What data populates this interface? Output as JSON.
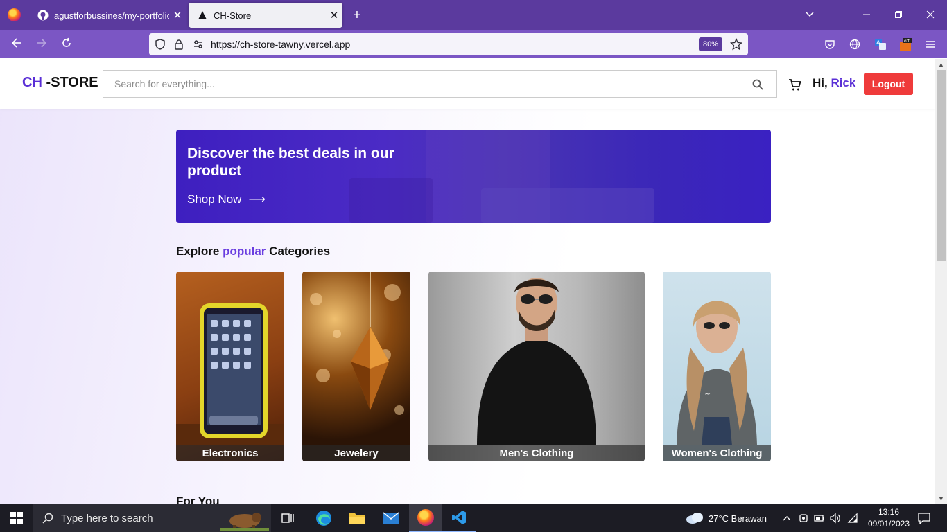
{
  "browser": {
    "tabs": [
      {
        "title": "agustforbussines/my-portfolio",
        "active": false,
        "icon": "github-icon"
      },
      {
        "title": "CH-Store",
        "active": true,
        "icon": "vercel-triangle-icon"
      }
    ],
    "new_tab": "+",
    "url": "https://ch-store-tawny.vercel.app",
    "zoom": "80%",
    "window_controls": {
      "dropdown": "⌄",
      "minimize": "—",
      "restore": "❐",
      "close": "✕"
    }
  },
  "site": {
    "logo_accent": "CH",
    "logo_rest": " -STORE",
    "search_placeholder": "Search for everything...",
    "greeting_prefix": "Hi, ",
    "user_name": "Rick",
    "logout_label": "Logout"
  },
  "hero": {
    "title": "Discover the best deals in our product",
    "cta": "Shop Now",
    "cta_arrow": "⟶"
  },
  "categories_section": {
    "title_before": "Explore ",
    "title_accent": "popular",
    "title_after": " Categories",
    "items": [
      {
        "label": "Electronics"
      },
      {
        "label": "Jewelery"
      },
      {
        "label": "Men's Clothing"
      },
      {
        "label": "Women's Clothing"
      }
    ]
  },
  "for_you": {
    "title": "For You"
  },
  "taskbar": {
    "search_placeholder": "Type here to search",
    "weather": "27°C  Berawan",
    "time": "13:16",
    "date": "09/01/2023"
  },
  "colors": {
    "tab_strip": "#5b3a9e",
    "nav_bar": "#7b56c4",
    "brand_accent": "#5a2fd6",
    "logout": "#ef3b3b",
    "hero": "#4326c4"
  }
}
